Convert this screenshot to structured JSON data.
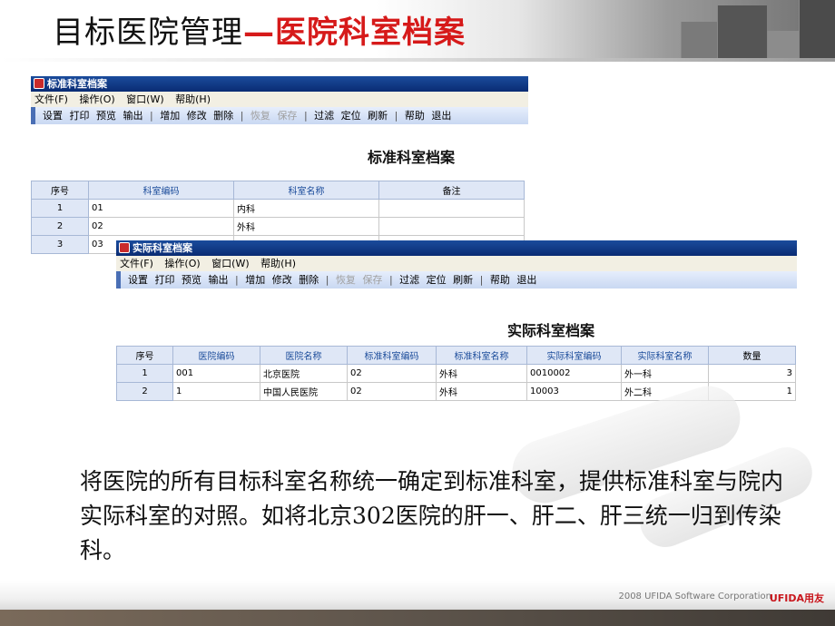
{
  "slide": {
    "title_part_a": "目标医院管理",
    "title_part_b": "—医院科室档案",
    "body_text": "将医院的所有目标科室名称统一确定到标准科室，提供标准科室与院内实际科室的对照。如将北京302医院的肝一、肝二、肝三统一归到传染科。",
    "footer_copyright": "2008 UFIDA Software Corporation",
    "footer_brand": "UFIDA用友",
    "colors": {
      "title_accent": "#d61a1a",
      "titlebar": "#0a2b73",
      "toolbar_accent": "#4a6fb5"
    }
  },
  "window_standard": {
    "title": "标准科室档案",
    "menu": [
      "文件(F)",
      "操作(O)",
      "窗口(W)",
      "帮助(H)"
    ],
    "toolbar": {
      "group1": [
        "设置",
        "打印",
        "预览",
        "输出"
      ],
      "group2": [
        "增加",
        "修改",
        "删除"
      ],
      "group2_disabled": [
        "恢复",
        "保存"
      ],
      "group3": [
        "过滤",
        "定位",
        "刷新"
      ],
      "group4": [
        "帮助",
        "退出"
      ]
    },
    "heading": "标准科室档案",
    "columns": [
      "序号",
      "科室编码",
      "科室名称",
      "备注"
    ],
    "rows": [
      [
        "1",
        "01",
        "内科",
        ""
      ],
      [
        "2",
        "02",
        "外科",
        ""
      ],
      [
        "3",
        "03",
        "",
        ""
      ]
    ]
  },
  "window_actual": {
    "title": "实际科室档案",
    "menu": [
      "文件(F)",
      "操作(O)",
      "窗口(W)",
      "帮助(H)"
    ],
    "toolbar": {
      "group1": [
        "设置",
        "打印",
        "预览",
        "输出"
      ],
      "group2": [
        "增加",
        "修改",
        "删除"
      ],
      "group2_disabled": [
        "恢复",
        "保存"
      ],
      "group3": [
        "过滤",
        "定位",
        "刷新"
      ],
      "group4": [
        "帮助",
        "退出"
      ]
    },
    "heading": "实际科室档案",
    "columns": [
      "序号",
      "医院编码",
      "医院名称",
      "标准科室编码",
      "标准科室名称",
      "实际科室编码",
      "实际科室名称",
      "数量"
    ],
    "rows": [
      [
        "1",
        "001",
        "北京医院",
        "02",
        "外科",
        "0010002",
        "外一科",
        "3"
      ],
      [
        "2",
        "1",
        "中国人民医院",
        "02",
        "外科",
        "10003",
        "外二科",
        "1"
      ]
    ]
  }
}
